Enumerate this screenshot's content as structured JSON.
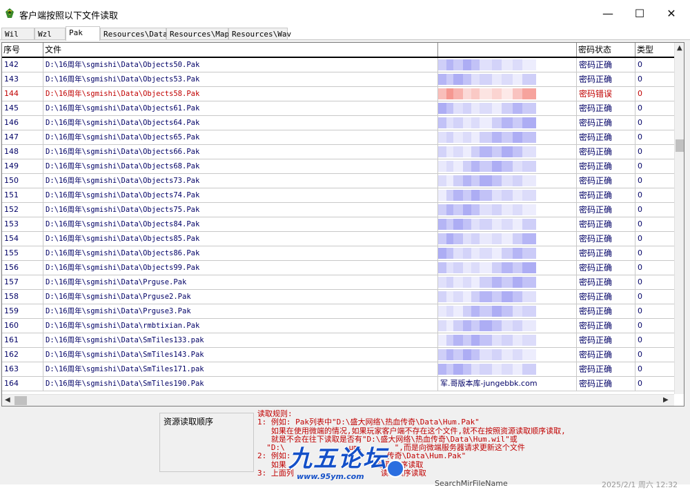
{
  "window": {
    "title": "客户端按照以下文件读取",
    "minimize": "—",
    "maximize": "☐",
    "close": "✕"
  },
  "tabs": [
    "Wil",
    "Wzl",
    "Pak",
    "Resources\\Data",
    "Resources\\Map",
    "Resources\\Wav"
  ],
  "active_tab": "Pak",
  "table": {
    "headers": [
      "序号",
      "文件",
      "",
      "密码状态",
      "类型"
    ],
    "rows": [
      {
        "idx": "142",
        "file": "D:\\16周年\\sgmishi\\Data\\Objects50.Pak",
        "blur": "",
        "status": "密码正确",
        "type": "0"
      },
      {
        "idx": "143",
        "file": "D:\\16周年\\sgmishi\\Data\\Objects53.Pak",
        "blur": "",
        "status": "密码正确",
        "type": "0"
      },
      {
        "idx": "144",
        "file": "D:\\16周年\\sgmishi\\Data\\Objects58.Pak",
        "blur": "",
        "status": "密码错误",
        "type": "0"
      },
      {
        "idx": "145",
        "file": "D:\\16周年\\sgmishi\\Data\\Objects61.Pak",
        "blur": "",
        "status": "密码正确",
        "type": "0"
      },
      {
        "idx": "146",
        "file": "D:\\16周年\\sgmishi\\Data\\Objects64.Pak",
        "blur": "",
        "status": "密码正确",
        "type": "0"
      },
      {
        "idx": "147",
        "file": "D:\\16周年\\sgmishi\\Data\\Objects65.Pak",
        "blur": "",
        "status": "密码正确",
        "type": "0"
      },
      {
        "idx": "148",
        "file": "D:\\16周年\\sgmishi\\Data\\Objects66.Pak",
        "blur": "",
        "status": "密码正确",
        "type": "0"
      },
      {
        "idx": "149",
        "file": "D:\\16周年\\sgmishi\\Data\\Objects68.Pak",
        "blur": "",
        "status": "密码正确",
        "type": "0"
      },
      {
        "idx": "150",
        "file": "D:\\16周年\\sgmishi\\Data\\Objects73.Pak",
        "blur": "",
        "status": "密码正确",
        "type": "0"
      },
      {
        "idx": "151",
        "file": "D:\\16周年\\sgmishi\\Data\\Objects74.Pak",
        "blur": "",
        "status": "密码正确",
        "type": "0"
      },
      {
        "idx": "152",
        "file": "D:\\16周年\\sgmishi\\Data\\Objects75.Pak",
        "blur": "",
        "status": "密码正确",
        "type": "0"
      },
      {
        "idx": "153",
        "file": "D:\\16周年\\sgmishi\\Data\\Objects84.Pak",
        "blur": "",
        "status": "密码正确",
        "type": "0"
      },
      {
        "idx": "154",
        "file": "D:\\16周年\\sgmishi\\Data\\Objects85.Pak",
        "blur": "",
        "status": "密码正确",
        "type": "0"
      },
      {
        "idx": "155",
        "file": "D:\\16周年\\sgmishi\\Data\\Objects86.Pak",
        "blur": "",
        "status": "密码正确",
        "type": "0"
      },
      {
        "idx": "156",
        "file": "D:\\16周年\\sgmishi\\Data\\Objects99.Pak",
        "blur": "",
        "status": "密码正确",
        "type": "0"
      },
      {
        "idx": "157",
        "file": "D:\\16周年\\sgmishi\\Data\\Prguse.Pak",
        "blur": "",
        "status": "密码正确",
        "type": "0"
      },
      {
        "idx": "158",
        "file": "D:\\16周年\\sgmishi\\Data\\Prguse2.Pak",
        "blur": "",
        "status": "密码正确",
        "type": "0"
      },
      {
        "idx": "159",
        "file": "D:\\16周年\\sgmishi\\Data\\Prguse3.Pak",
        "blur": "",
        "status": "密码正确",
        "type": "0"
      },
      {
        "idx": "160",
        "file": "D:\\16周年\\sgmishi\\Data\\rmbtixian.Pak",
        "blur": "",
        "status": "密码正确",
        "type": "0"
      },
      {
        "idx": "161",
        "file": "D:\\16周年\\sgmishi\\Data\\SmTiles133.pak",
        "blur": "",
        "status": "密码正确",
        "type": "0"
      },
      {
        "idx": "162",
        "file": "D:\\16周年\\sgmishi\\Data\\SmTiles143.Pak",
        "blur": "",
        "status": "密码正确",
        "type": "0"
      },
      {
        "idx": "163",
        "file": "D:\\16周年\\sgmishi\\Data\\SmTiles171.pak",
        "blur": "",
        "status": "密码正确",
        "type": "0"
      },
      {
        "idx": "164",
        "file": "D:\\16周年\\sgmishi\\Data\\SmTiles190.Pak",
        "blur": "军.哥版本库-jungebbk.com",
        "status": "密码正确",
        "type": "0"
      }
    ]
  },
  "colors": {
    "normal_text": "#000066",
    "error_text": "#c00000",
    "rules_text": "#c00000",
    "blur_normal": "#a8a8f4",
    "blur_error": "#f4a8a8",
    "watermark": "#1450c8"
  },
  "bottom": {
    "order_label": "资源读取顺序",
    "rules": [
      "读取规则:",
      "1: 例如: Pak列表中\"D:\\盛大网络\\热血传奇\\Data\\Hum.Pak\"",
      "   如果在使用微端的情况,如果玩家客户端不存在这个文件,就不在按照资源读取顺序读取,",
      "   就是不会在往下读取是否有\"D:\\盛大网络\\热血传奇\\Data\\Hum.wil\"或",
      "  \"D:\\              um.       \",而是向微端服务器请求更新这个文件",
      "2: 例如:                     传奇\\Data\\Hum.Pak\"",
      "   如果                    读取顺序读取",
      "3: 上面列                   读取顺序读取"
    ],
    "watermark": "九五论坛",
    "watermark_url": "www.95ym.com",
    "cutoff_text": "SearchMirFileName",
    "cutoff_date": "2025/2/1 周六 12:32"
  }
}
